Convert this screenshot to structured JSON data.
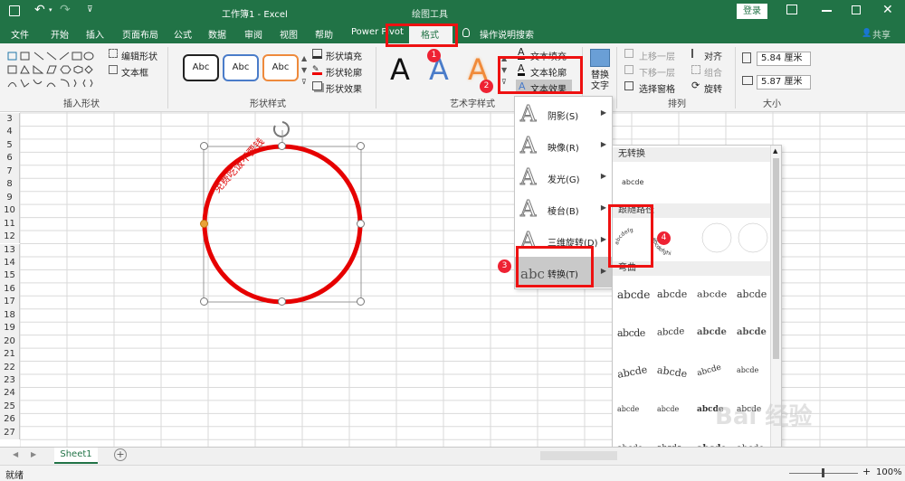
{
  "titlebar": {
    "workbook": "工作簿1 - Excel",
    "context_tab": "绘图工具",
    "login": "登录"
  },
  "tabs": {
    "file": "文件",
    "home": "开始",
    "insert": "插入",
    "layout": "页面布局",
    "formula": "公式",
    "data": "数据",
    "review": "审阅",
    "view": "视图",
    "help": "帮助",
    "powerpivot": "Power Pivot",
    "format": "格式",
    "search": "操作说明搜索",
    "share": "共享"
  },
  "ribbon": {
    "edit_shape": "编辑形状",
    "text_box": "文本框",
    "insert_shapes": "插入形状",
    "style_sample": "Abc",
    "shape_fill": "形状填充",
    "shape_outline": "形状轮廓",
    "shape_effect": "形状效果",
    "shape_styles": "形状样式",
    "wordart_letter": "A",
    "text_fill": "文本填充",
    "text_outline": "文本轮廓",
    "text_effect": "文本效果",
    "wordart_styles": "艺术字样式",
    "alt_text": "替换文字",
    "bring_forward": "上移一层",
    "send_backward": "下移一层",
    "selection_pane": "选择窗格",
    "align": "对齐",
    "group": "组合",
    "rotate": "旋转",
    "arrange": "排列",
    "height": "5.84 厘米",
    "width": "5.87 厘米",
    "size": "大小"
  },
  "sheet": {
    "rows": [
      "3",
      "4",
      "5",
      "6",
      "7",
      "8",
      "9",
      "10",
      "11",
      "12",
      "13",
      "14",
      "15",
      "16",
      "17",
      "18",
      "19",
      "20",
      "21",
      "22",
      "23",
      "24",
      "25",
      "26",
      "27"
    ],
    "wordart_text": "免费吃饭不要钱",
    "tab_name": "Sheet1",
    "status": "就绪",
    "zoom": "100%"
  },
  "menu": {
    "items": [
      {
        "icon": "A",
        "label": "阴影(S)"
      },
      {
        "icon": "A",
        "label": "映像(R)"
      },
      {
        "icon": "A",
        "label": "发光(G)"
      },
      {
        "icon": "A",
        "label": "棱台(B)"
      },
      {
        "icon": "A",
        "label": "三维旋转(D)"
      },
      {
        "icon": "abc",
        "label": "转换(T)"
      }
    ]
  },
  "submenu": {
    "no_transform": "无转换",
    "plain_sample": "abcde",
    "follow_path": "跟随路径",
    "warp": "弯曲",
    "sample": "abcde",
    "more": "....."
  },
  "badges": [
    "1",
    "2",
    "3",
    "4"
  ],
  "watermark": "Bai 经验",
  "colors": {
    "excel_green": "#217346",
    "highlight_red": "#e11111",
    "shape_red": "#e60000"
  }
}
